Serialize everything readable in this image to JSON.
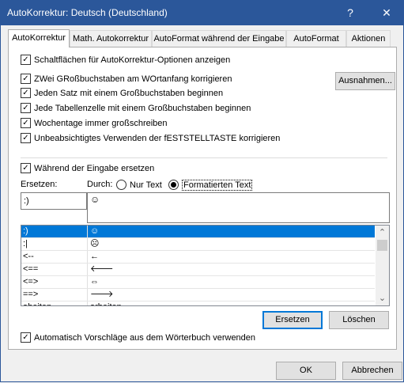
{
  "window": {
    "title": "AutoKorrektur: Deutsch (Deutschland)",
    "help_glyph": "?",
    "close_glyph": "✕"
  },
  "tabs": [
    {
      "label": "AutoKorrektur",
      "active": true
    },
    {
      "label": "Math. Autokorrektur",
      "active": false
    },
    {
      "label": "AutoFormat während der Eingabe",
      "active": false
    },
    {
      "label": "AutoFormat",
      "active": false
    },
    {
      "label": "Aktionen",
      "active": false
    }
  ],
  "options": {
    "show_buttons": {
      "label": "Schaltflächen für AutoKorrektur-Optionen anzeigen",
      "checked": true
    },
    "two_caps": {
      "label": "ZWei GRoßbuchstaben am WOrtanfang korrigieren",
      "checked": true
    },
    "sentence": {
      "label": "Jeden Satz mit einem Großbuchstaben beginnen",
      "checked": true
    },
    "table_cell": {
      "label": "Jede Tabellenzelle mit einem Großbuchstaben beginnen",
      "checked": true
    },
    "weekdays": {
      "label": "Wochentage immer großschreiben",
      "checked": true
    },
    "caps_lock": {
      "label": "Unbeabsichtigtes Verwenden der fESTSTELLTASTE korrigieren",
      "checked": true
    },
    "replace_while_typing": {
      "label": "Während der Eingabe ersetzen",
      "checked": true
    },
    "suggestions": {
      "label": "Automatisch Vorschläge aus dem Wörterbuch verwenden",
      "checked": true
    }
  },
  "buttons": {
    "exceptions": "Ausnahmen...",
    "replace": "Ersetzen",
    "delete": "Löschen",
    "ok": "OK",
    "cancel": "Abbrechen"
  },
  "replace_section": {
    "replace_label": "Ersetzen:",
    "with_label": "Durch:",
    "radio_plain": "Nur Text",
    "radio_formatted": "Formatierten Text",
    "selected_radio": "formatted",
    "replace_value": ":)",
    "with_value": "☺"
  },
  "entries": [
    {
      "from": ":)",
      "to": "☺",
      "selected": true
    },
    {
      "from": ":|",
      "to": "☹",
      "selected": false
    },
    {
      "from": "<--",
      "to": "←",
      "selected": false
    },
    {
      "from": "<==",
      "to": "🡐",
      "selected": false
    },
    {
      "from": "<=>",
      "to": "⇔",
      "selected": false
    },
    {
      "from": "==>",
      "to": "🡒",
      "selected": false
    },
    {
      "from": "abeiten",
      "to": "arbeiten",
      "selected": false
    }
  ],
  "scrollbar": {
    "up": "⌃",
    "down": "⌄"
  }
}
